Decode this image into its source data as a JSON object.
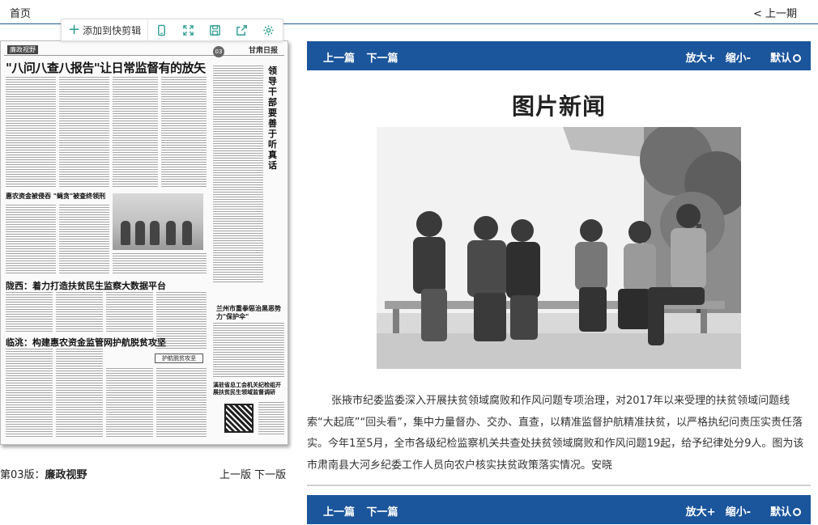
{
  "topbar": {
    "home": "首页",
    "prev_period": "< 上一期"
  },
  "toolbar": {
    "add_clip": "添加到快剪辑",
    "icons": [
      "phone-icon",
      "fullscreen-icon",
      "save-icon",
      "share-icon",
      "settings-icon"
    ]
  },
  "paper": {
    "column_tag": "廉政视野",
    "masthead": "甘肃日报",
    "page_no": "03",
    "headline": "\"八问八查八报告\"让日常监督有的放矢",
    "side_headline": "领导干部要善于听真话",
    "sub1": "惠农资金被侵吞 \"蝇贪\"被查终领刑",
    "sub2": "陇西：着力打造扶贫民生监察大数据平台",
    "sub3": "临洮：构建惠农资金监管网护航脱贫攻坚",
    "side2": "兰州市重拳惩治黑恶势力\"保护伞\"",
    "side3": "溪驻省总工会机关纪检组开展扶贫民生领域监督调研",
    "stamp": "护航脱贫攻坚"
  },
  "edition": {
    "label": "第03版：",
    "name": "廉政视野",
    "prev_version": "上一版",
    "next_version": "下一版"
  },
  "article_bar": {
    "prev": "上一篇",
    "next": "下一篇",
    "zoom_in": "放大+",
    "zoom_out": "缩小-",
    "default": "默认"
  },
  "article": {
    "title": "图片新闻",
    "body": "张掖市纪委监委深入开展扶贫领域腐败和作风问题专项治理，对2017年以来受理的扶贫领域问题线索“大起底”“回头看”，集中力量督办、交办、直查，以精准监督护航精准扶贫，以严格执纪问责压实责任落实。今年1至5月，全市各级纪检监察机关共查处扶贫领域腐败和作风问题19起，给予纪律处分9人。图为该市肃南县大河乡纪委工作人员向农户核实扶贫政策落实情况。安晓"
  },
  "colors": {
    "accent": "#1b559b",
    "toolbar_icon": "#2a9d8f"
  }
}
